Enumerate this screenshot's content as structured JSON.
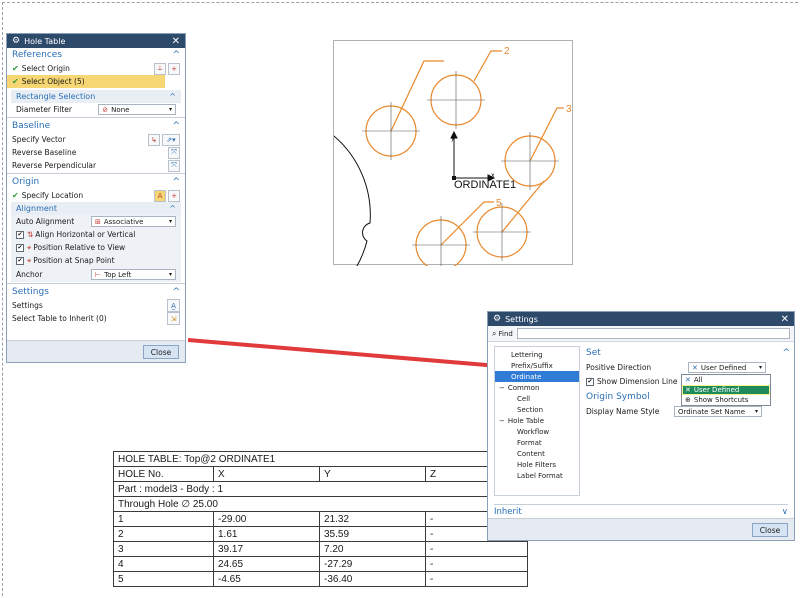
{
  "hole_dialog": {
    "title": "Hole Table",
    "references": {
      "label": "References",
      "select_origin": "Select Origin",
      "select_object": "Select Object (5)",
      "rect_sel": "Rectangle Selection",
      "diameter_filter_label": "Diameter Filter",
      "diameter_filter_value": "None"
    },
    "baseline": {
      "label": "Baseline",
      "specify_vector": "Specify Vector",
      "reverse_baseline": "Reverse Baseline",
      "reverse_perpendicular": "Reverse Perpendicular"
    },
    "origin": {
      "label": "Origin",
      "specify_location": "Specify Location",
      "alignment": "Alignment",
      "auto_alignment_label": "Auto Alignment",
      "auto_alignment_value": "Associative",
      "align_hv": "Align Horizontal or Vertical",
      "position_relative": "Position Relative to View",
      "position_snap": "Position at Snap Point",
      "anchor_label": "Anchor",
      "anchor_value": "Top Left"
    },
    "settings": {
      "label": "Settings",
      "settings_row": "Settings",
      "inherit_row": "Select Table to Inherit (0)"
    },
    "close": "Close"
  },
  "diagram": {
    "origin_label": "ORDINATE1",
    "x_axis": "x",
    "y_axis": "y",
    "callouts": [
      "2",
      "3",
      "5"
    ],
    "accent": "#e8892c"
  },
  "hole_table": {
    "title": "HOLE TABLE: Top@2 ORDINATE1",
    "headers": [
      "HOLE No.",
      "X",
      "Y",
      "Z"
    ],
    "part": "Part : model3 - Body : 1",
    "through": "Through Hole ∅ 25.00",
    "rows": [
      [
        "1",
        "-29.00",
        "21.32",
        "-"
      ],
      [
        "2",
        "1.61",
        "35.59",
        "-"
      ],
      [
        "3",
        "39.17",
        "7.20",
        "-"
      ],
      [
        "4",
        "24.65",
        "-27.29",
        "-"
      ],
      [
        "5",
        "-4.65",
        "-36.40",
        "-"
      ]
    ]
  },
  "settings_dialog": {
    "title": "Settings",
    "find_label": "Find",
    "find_value": "",
    "tree": [
      "Lettering",
      "Prefix/Suffix",
      "Ordinate",
      "Common",
      "Cell",
      "Section",
      "Hole Table",
      "Workflow",
      "Format",
      "Content",
      "Hole Filters",
      "Label Format"
    ],
    "set_label": "Set",
    "positive_direction_label": "Positive Direction",
    "positive_direction_value": "User Defined",
    "show_dimension_line": "Show Dimension Line",
    "dropdown_options": [
      "All",
      "User Defined",
      "Show Shortcuts"
    ],
    "origin_symbol": "Origin Symbol",
    "display_name_label": "Display Name Style",
    "display_name_value": "Ordinate Set Name",
    "inherit_label": "Inherit",
    "close": "Close"
  },
  "colors": {
    "title_bar": "#2e4a6b",
    "accent_blue": "#2a6fb5",
    "arrow_red": "#e03a3a",
    "highlight": "#f7d774"
  }
}
